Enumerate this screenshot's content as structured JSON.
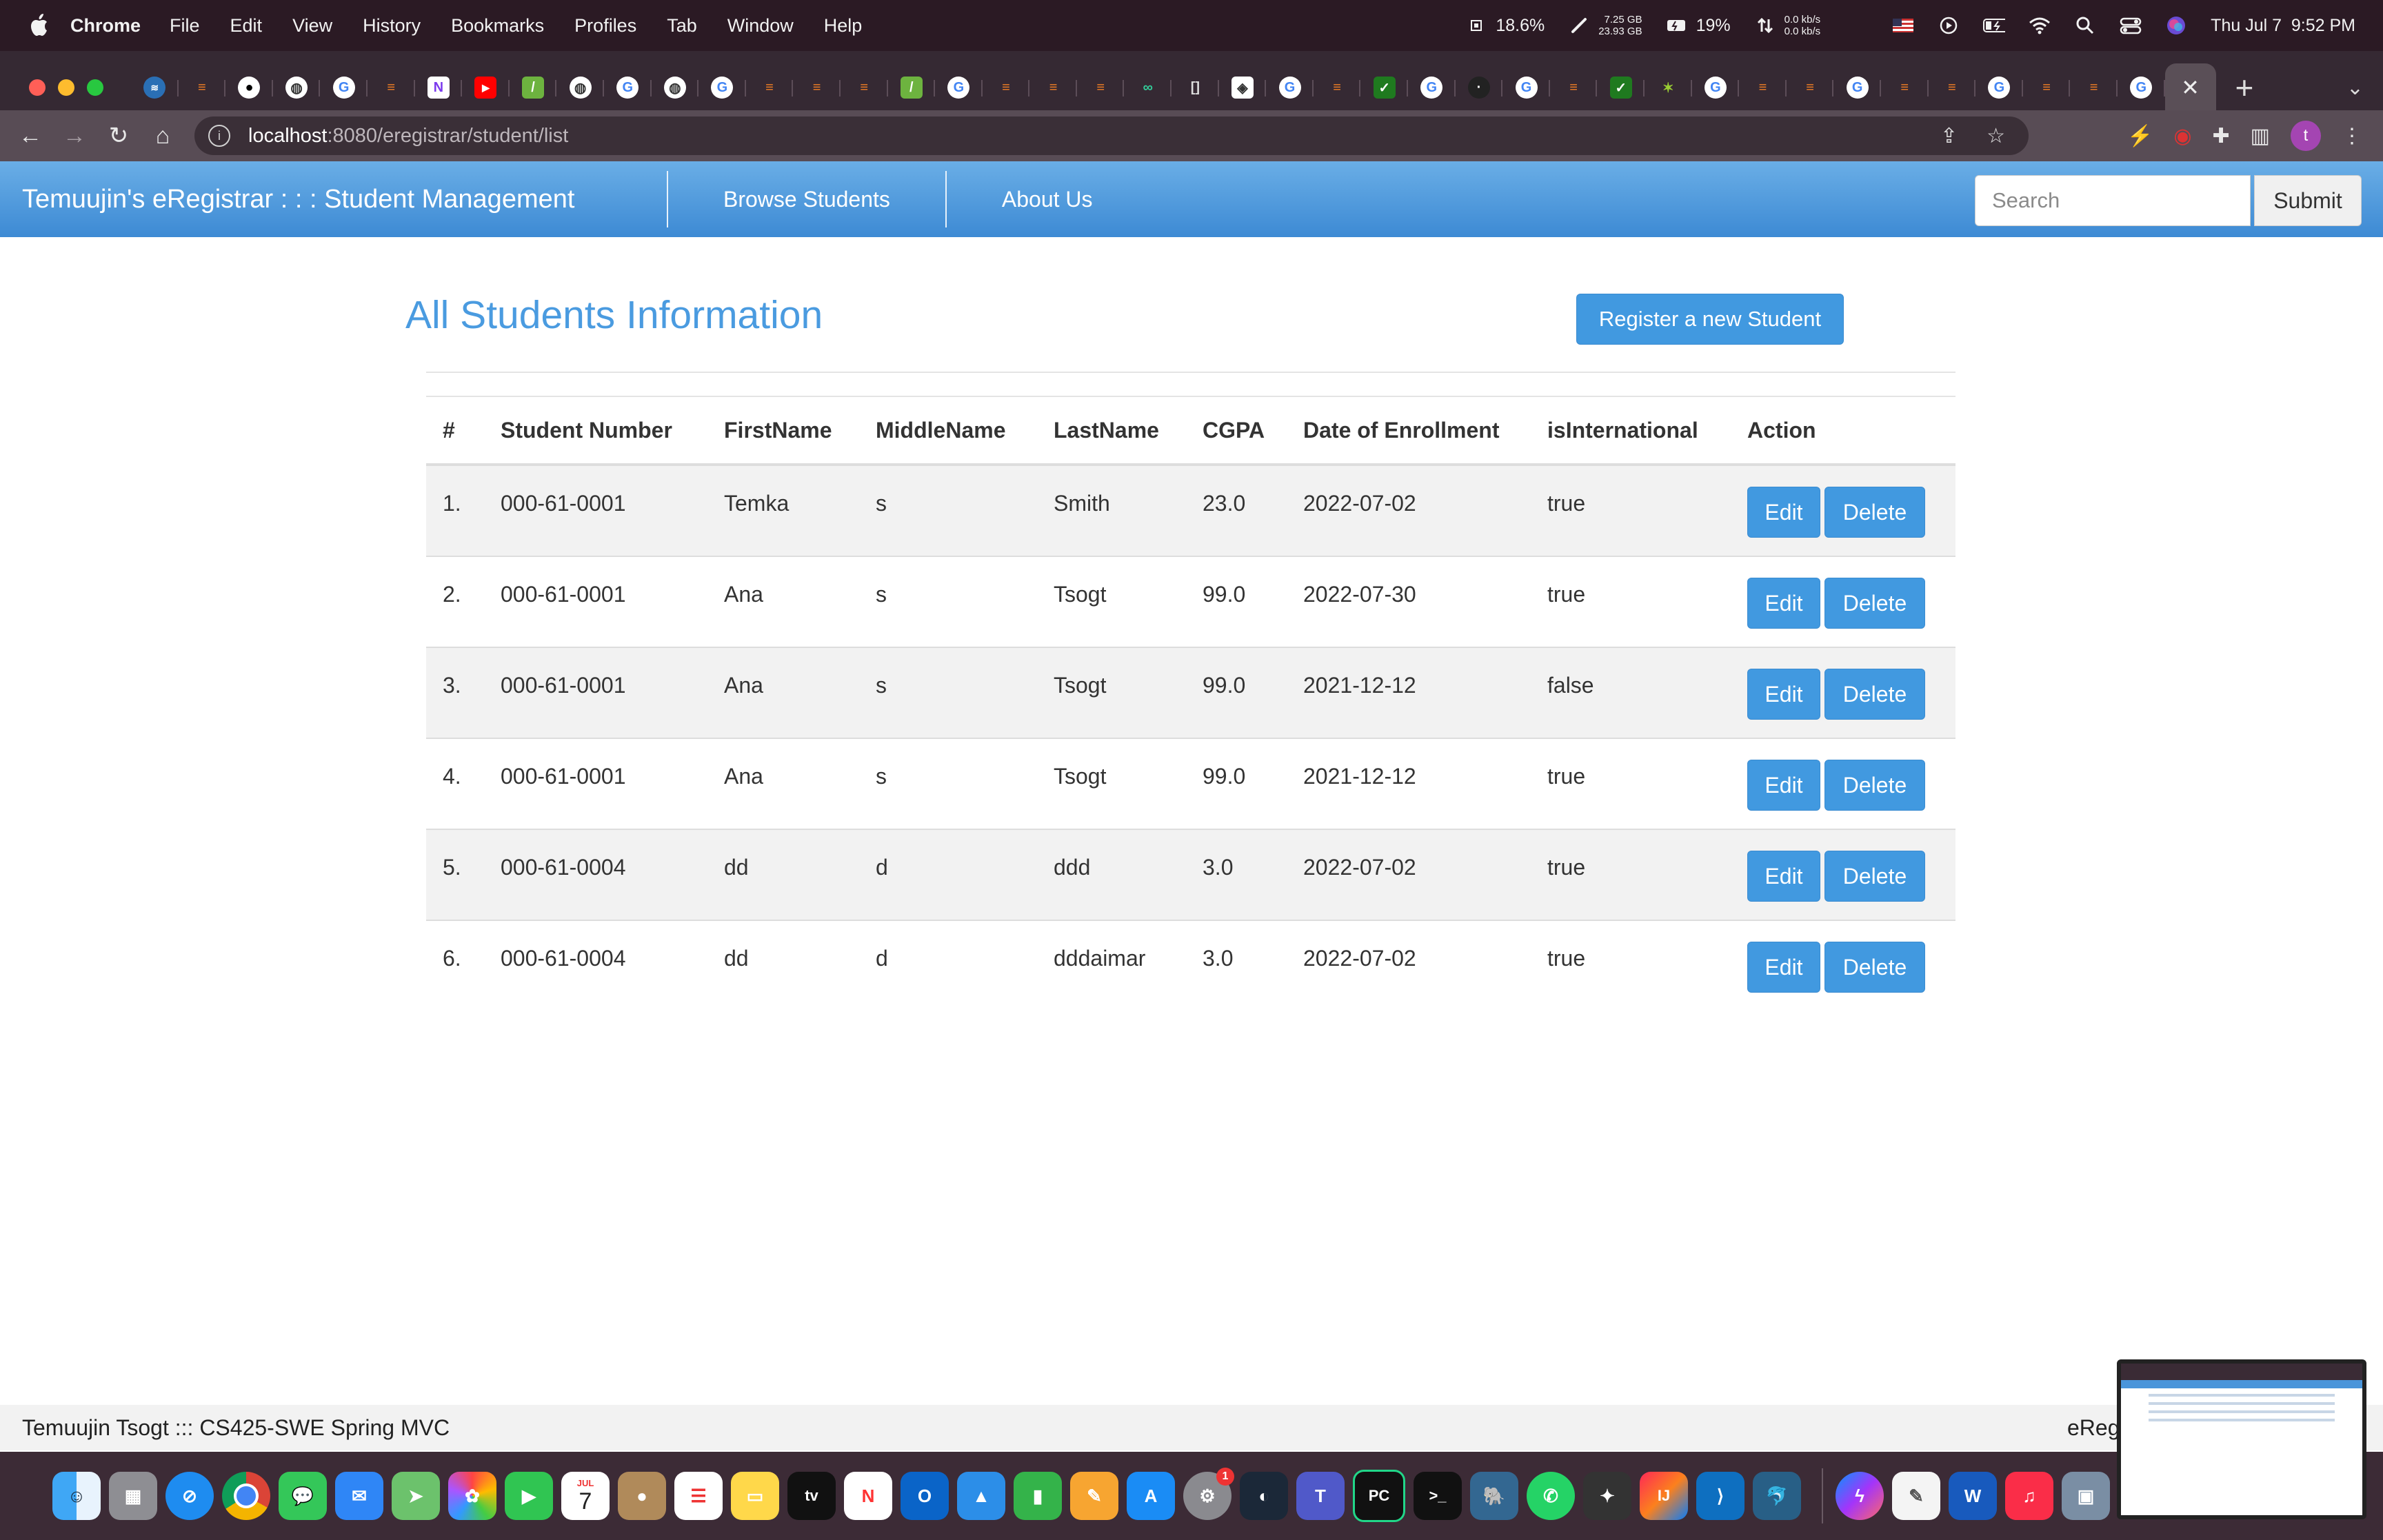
{
  "menubar": {
    "app_name": "Chrome",
    "menus": [
      "File",
      "Edit",
      "View",
      "History",
      "Bookmarks",
      "Profiles",
      "Tab",
      "Window",
      "Help"
    ],
    "cpu": "18.6%",
    "memory_used": "7.25 GB",
    "memory_total": "23.93 GB",
    "battery": "19%",
    "net_up": "0.0 kb/s",
    "net_down": "0.0 kb/s",
    "datetime": "Thu Jul 7  9:52 PM"
  },
  "browser": {
    "url_host": "localhost",
    "url_path": ":8080/eregistrar/student/list",
    "avatar_letter": "t"
  },
  "navbar": {
    "brand": "Temuujin's eRegistrar : : : Student Management",
    "links": [
      "Browse Students",
      "About Us"
    ],
    "search_placeholder": "Search",
    "submit_label": "Submit"
  },
  "main": {
    "heading": "All Students Information",
    "register_label": "Register a new Student",
    "columns": [
      "#",
      "Student Number",
      "FirstName",
      "MiddleName",
      "LastName",
      "CGPA",
      "Date of Enrollment",
      "isInternational",
      "Action"
    ],
    "edit_label": "Edit",
    "delete_label": "Delete",
    "rows": [
      {
        "num": "1.",
        "student_number": "000-61-0001",
        "first": "Temka",
        "middle": "s",
        "last": "Smith",
        "cgpa": "23.0",
        "date": "2022-07-02",
        "intl": "true"
      },
      {
        "num": "2.",
        "student_number": "000-61-0001",
        "first": "Ana",
        "middle": "s",
        "last": "Tsogt",
        "cgpa": "99.0",
        "date": "2022-07-30",
        "intl": "true"
      },
      {
        "num": "3.",
        "student_number": "000-61-0001",
        "first": "Ana",
        "middle": "s",
        "last": "Tsogt",
        "cgpa": "99.0",
        "date": "2021-12-12",
        "intl": "false"
      },
      {
        "num": "4.",
        "student_number": "000-61-0001",
        "first": "Ana",
        "middle": "s",
        "last": "Tsogt",
        "cgpa": "99.0",
        "date": "2021-12-12",
        "intl": "true"
      },
      {
        "num": "5.",
        "student_number": "000-61-0004",
        "first": "dd",
        "middle": "d",
        "last": "ddd",
        "cgpa": "3.0",
        "date": "2022-07-02",
        "intl": "true"
      },
      {
        "num": "6.",
        "student_number": "000-61-0004",
        "first": "dd",
        "middle": "d",
        "last": "dddaimar",
        "cgpa": "3.0",
        "date": "2022-07-02",
        "intl": "true"
      }
    ]
  },
  "footer": {
    "left": "Temuujin Tsogt ::: CS425-SWE Spring MVC",
    "right": "eReg"
  },
  "dock": {
    "calendar_month": "JUL",
    "calendar_day": "7",
    "settings_badge": "1"
  },
  "colors": {
    "navbar_top": "#6aaee6",
    "navbar_bottom": "#3d8ad4",
    "heading": "#4a9be0",
    "button": "#4199e0"
  }
}
